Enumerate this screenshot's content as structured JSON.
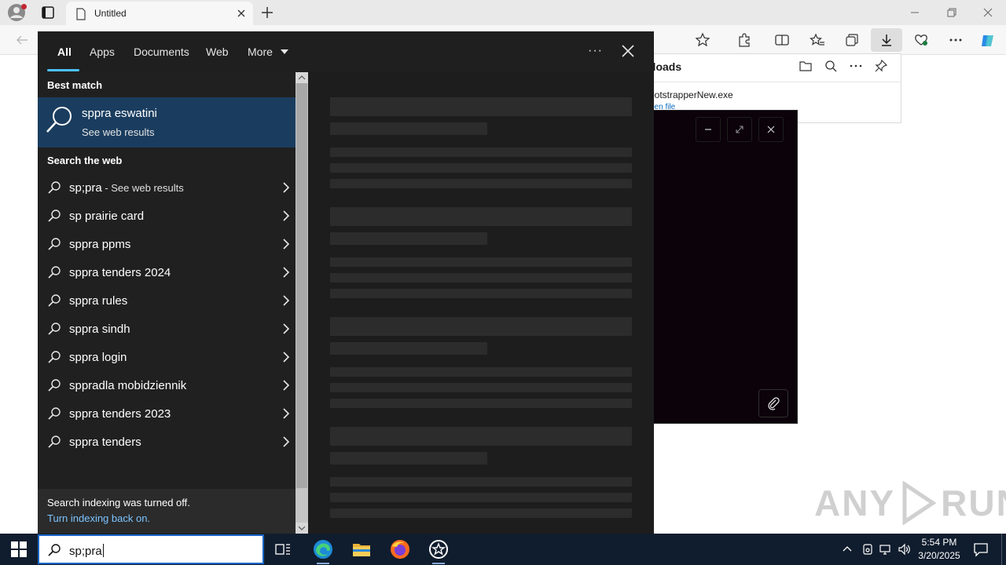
{
  "browser": {
    "tab_title": "Untitled",
    "downloads": {
      "title_fragment": "nloads",
      "file_fragment": "ootstrapperNew.exe",
      "open_file_fragment": "pen file"
    }
  },
  "search": {
    "tabs": [
      {
        "label": "All"
      },
      {
        "label": "Apps"
      },
      {
        "label": "Documents"
      },
      {
        "label": "Web"
      },
      {
        "label": "More"
      }
    ],
    "more_options": "···",
    "best_match": {
      "heading": "Best match",
      "title": "sppra eswatini",
      "subtitle": "See web results"
    },
    "web": {
      "heading": "Search the web",
      "items": [
        {
          "label": "sp;pra",
          "suffix": " - See web results"
        },
        {
          "label": "sp prairie card"
        },
        {
          "label": "sppra ppms"
        },
        {
          "label": "sppra tenders 2024"
        },
        {
          "label": "sppra rules"
        },
        {
          "label": "sppra sindh"
        },
        {
          "label": "sppra login"
        },
        {
          "label": "sppradla mobidziennik"
        },
        {
          "label": "sppra tenders 2023"
        },
        {
          "label": "sppra tenders"
        }
      ]
    },
    "footer": {
      "notice": "Search indexing was turned off.",
      "link": "Turn indexing back on."
    }
  },
  "taskbar": {
    "search_value": "sp;pra",
    "time": "5:54 PM",
    "date": "3/20/2025"
  },
  "watermark": {
    "text_left": "ANY",
    "text_right": "RUN"
  },
  "colors": {
    "search_bg": "#202020",
    "best_match_bg": "#1a3d5f",
    "accent": "#4cc2ff",
    "taskbar_bg": "#101d2e"
  }
}
